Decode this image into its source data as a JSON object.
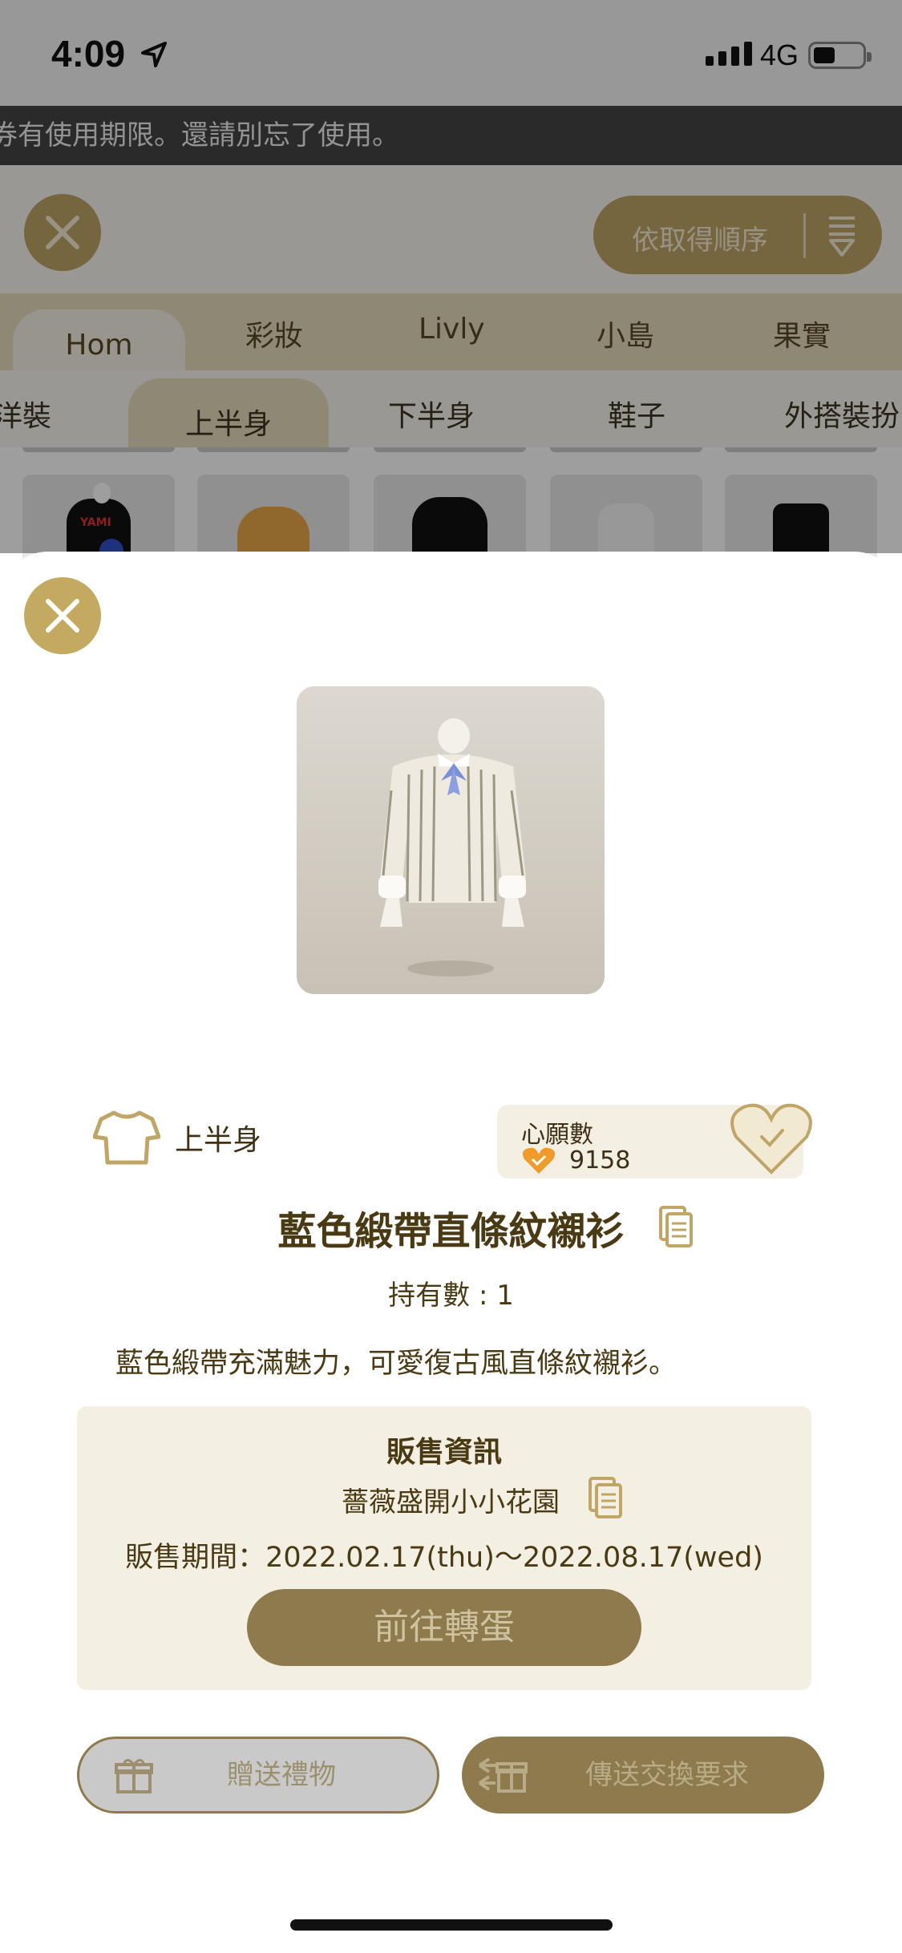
{
  "status_bar": {
    "time": "4:09",
    "network": "4G"
  },
  "banner": {
    "text": "券有使用期限。還請別忘了使用。"
  },
  "toolbar": {
    "sort_label": "依取得順序"
  },
  "category_tabs": [
    {
      "label": "Hom",
      "active": true
    },
    {
      "label": "彩妝",
      "active": false
    },
    {
      "label": "Livly",
      "active": false
    },
    {
      "label": "小島",
      "active": false
    },
    {
      "label": "果實",
      "active": false
    }
  ],
  "sub_tabs": [
    {
      "label": "洋裝",
      "active": false
    },
    {
      "label": "上半身",
      "active": true
    },
    {
      "label": "下半身",
      "active": false
    },
    {
      "label": "鞋子",
      "active": false
    },
    {
      "label": "外搭裝扮",
      "active": false
    }
  ],
  "grid_thumb_labels": [
    "YAMI"
  ],
  "detail": {
    "category": "上半身",
    "wish_label": "心願數",
    "wish_count": "9158",
    "title": "藍色緞帶直條紋襯衫",
    "owned": "持有數 : 1",
    "description": "藍色緞帶充滿魅力，可愛復古風直條紋襯衫。",
    "sales": {
      "heading": "販售資訊",
      "event": "薔薇盛開小小花園",
      "period": "販售期間：2022.02.17(thu)～2022.08.17(wed)",
      "go_button": "前往轉蛋"
    },
    "gift_button": "贈送禮物",
    "trade_button": "傳送交換要求"
  },
  "colors": {
    "accent": "#bfa566",
    "dark_gold": "#8e7a4c",
    "cream": "#f4efe3",
    "text": "#4a3a14"
  }
}
